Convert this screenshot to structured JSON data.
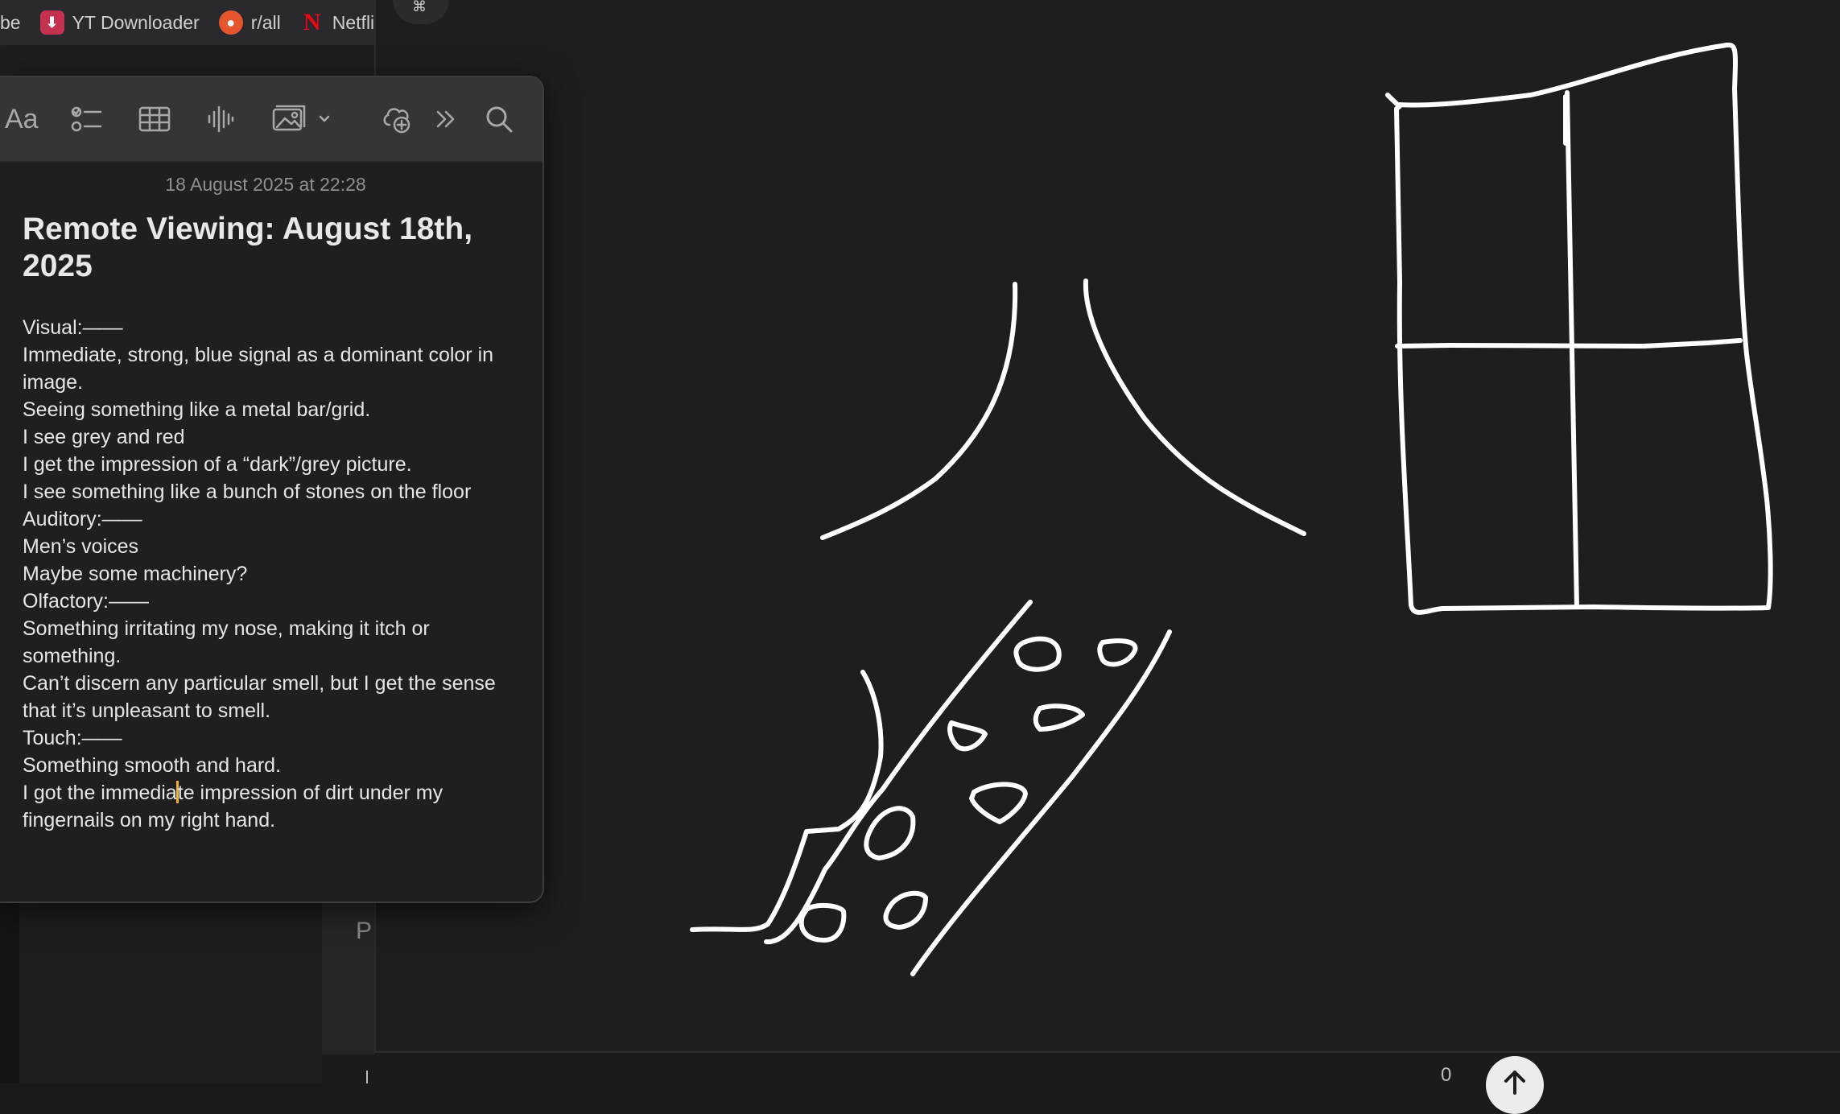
{
  "bookmarks": [
    {
      "label": "be",
      "icon": "none"
    },
    {
      "label": "YT Downloader",
      "icon": "download-icon"
    },
    {
      "label": "r/all",
      "icon": "reddit-icon"
    },
    {
      "label": "Netfli",
      "icon": "netflix-icon"
    }
  ],
  "toolbar": {
    "format_label": "Aa",
    "buttons": [
      "format",
      "checklist",
      "table",
      "audio",
      "media",
      "collaborate",
      "more",
      "search"
    ]
  },
  "note": {
    "date": "18 August 2025 at 22:28",
    "title": "Remote Viewing: August 18th, 2025",
    "lines": [
      "Visual:——",
      "Immediate, strong, blue signal as a dominant color in image.",
      "Seeing something like a metal bar/grid.",
      "I see grey and red",
      "I get the impression of a “dark”/grey picture.",
      "I see something like a bunch of stones on the floor",
      "Auditory:——",
      "Men’s voices",
      "Maybe some machinery?",
      "Olfactory:——",
      "Something irritating my nose, making it itch or something.",
      "Can’t discern any particular smell, but I get the sense that it’s unpleasant to smell.",
      "Touch:——",
      "Something smooth and hard."
    ],
    "last_line_before_caret": "I got the immedia",
    "last_line_after_caret": "te impression of dirt under my fingernails on my right hand."
  },
  "canvas": {
    "top_button_glyph": "⌘",
    "left_char": "P",
    "bottom_count": "0"
  },
  "colors": {
    "background": "#1e1e1e",
    "stroke": "#ffffff",
    "caret": "#e7b532"
  }
}
